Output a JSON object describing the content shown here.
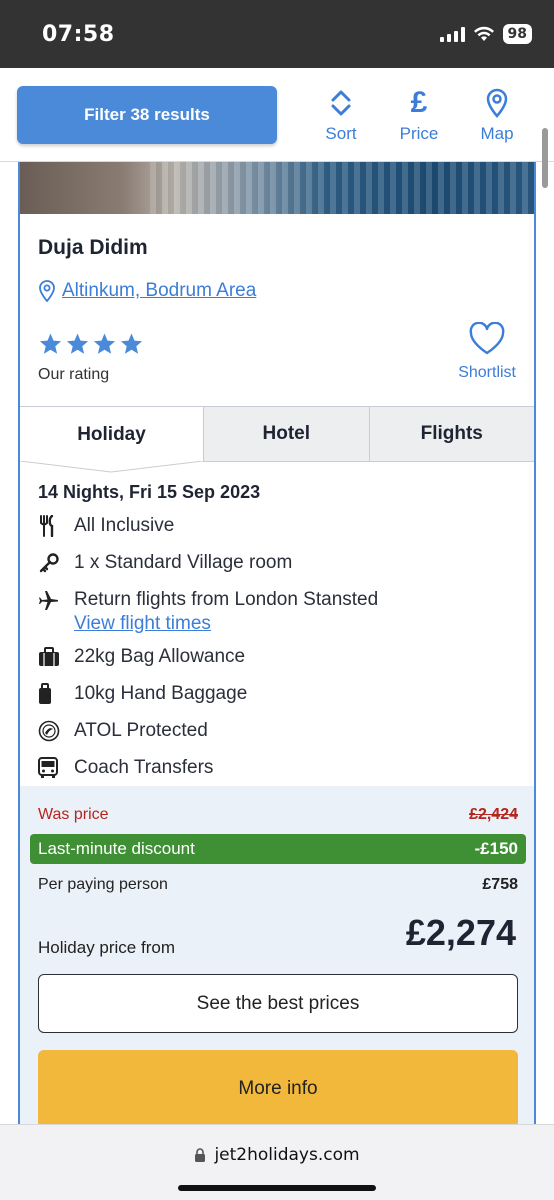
{
  "status_bar": {
    "time": "07:58",
    "battery": "98"
  },
  "toolbar": {
    "filter_label": "Filter 38 results",
    "sort_label": "Sort",
    "price_label": "Price",
    "price_glyph": "£",
    "map_label": "Map"
  },
  "hotel": {
    "name": "Duja Didim",
    "location": "Altinkum, Bodrum Area",
    "star_rating": 4,
    "rating_label": "Our rating",
    "shortlist_label": "Shortlist"
  },
  "tabs": [
    {
      "label": "Holiday",
      "active": true
    },
    {
      "label": "Hotel",
      "active": false
    },
    {
      "label": "Flights",
      "active": false
    }
  ],
  "holiday": {
    "dates": "14 Nights, Fri 15 Sep 2023",
    "features": [
      {
        "icon": "cutlery-icon",
        "text": "All Inclusive"
      },
      {
        "icon": "key-icon",
        "text": "1 x Standard Village room"
      },
      {
        "icon": "plane-icon",
        "text": "Return flights from London Stansted",
        "link": "View flight times"
      },
      {
        "icon": "suitcase-icon",
        "text": "22kg Bag Allowance"
      },
      {
        "icon": "hand-luggage-icon",
        "text": "10kg Hand Baggage"
      },
      {
        "icon": "atol-icon",
        "text": "ATOL Protected"
      },
      {
        "icon": "bus-icon",
        "text": "Coach Transfers"
      }
    ]
  },
  "pricing": {
    "was_label": "Was price",
    "was_amount": "£2,424",
    "discount_label": "Last-minute discount",
    "discount_amount": "-£150",
    "per_person_label": "Per paying person",
    "per_person_amount": "£758",
    "from_label": "Holiday price from",
    "from_amount": "£2,274",
    "best_prices_label": "See the best prices",
    "more_info_label": "More info"
  },
  "browser": {
    "url": "jet2holidays.com"
  },
  "colors": {
    "accent_blue": "#3b7dd8",
    "filter_button": "#4b8ad8",
    "discount_green": "#3f8f35",
    "was_red": "#b3261e",
    "more_info_yellow": "#f2b83b",
    "price_panel_bg": "#ebf1f8"
  }
}
